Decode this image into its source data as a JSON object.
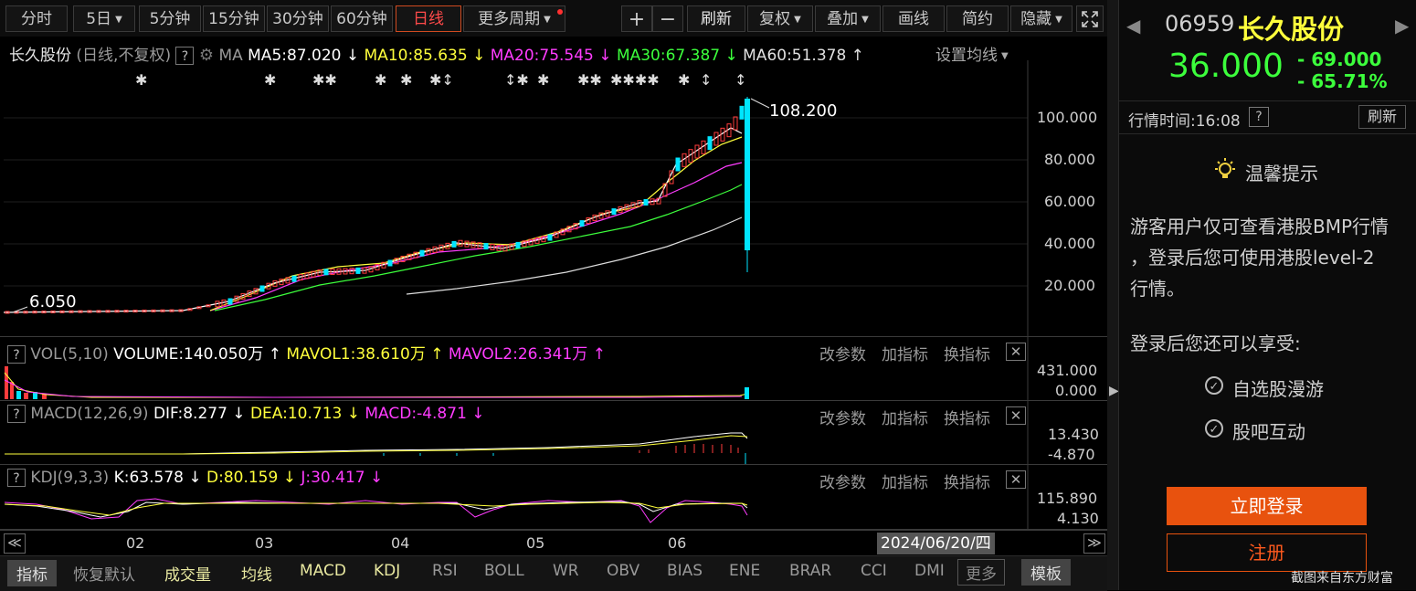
{
  "toolbar": {
    "periods": [
      "分时",
      "5日",
      "5分钟",
      "15分钟",
      "30分钟",
      "60分钟",
      "日线",
      "更多周期"
    ],
    "selected": "日线",
    "plus": "+",
    "minus": "−",
    "refresh": "刷新",
    "adjust": "复权",
    "overlay": "叠加",
    "draw": "画线",
    "simple": "简约",
    "hide": "隐藏",
    "fullscreen_icon": "fullscreen-icon"
  },
  "main_legend": {
    "stock": "长久股份",
    "mode": "(日线,不复权)",
    "help": "?",
    "gear_icon": "gear-icon",
    "ma": "MA",
    "ma5": "MA5:87.020 ↓",
    "ma10": "MA10:85.635 ↓",
    "ma20": "MA20:75.545 ↓",
    "ma30": "MA30:67.387 ↓",
    "ma60": "MA60:51.378 ↑",
    "set_ma": "设置均线"
  },
  "price_axis": [
    "100.000",
    "80.000",
    "60.000",
    "40.000",
    "20.000"
  ],
  "annotations": {
    "high": "108.200",
    "low": "6.050"
  },
  "vol_panel": {
    "help": "?",
    "name": "VOL(5,10)",
    "volume": "VOLUME:140.050万 ↑",
    "mavol1": "MAVOL1:38.610万 ↑",
    "mavol2": "MAVOL2:26.341万 ↑",
    "axis": [
      "431.000",
      "0.000"
    ]
  },
  "macd_panel": {
    "help": "?",
    "name": "MACD(12,26,9)",
    "dif": "DIF:8.277 ↓",
    "dea": "DEA:10.713 ↓",
    "macd": "MACD:-4.871 ↓",
    "axis": [
      "13.430",
      "-4.870"
    ]
  },
  "kdj_panel": {
    "help": "?",
    "name": "KDJ(9,3,3)",
    "k": "K:63.578 ↓",
    "d": "D:80.159 ↓",
    "j": "J:30.417 ↓",
    "axis": [
      "115.890",
      "4.130"
    ]
  },
  "panel_buttons": {
    "params": "改参数",
    "add": "加指标",
    "switch": "换指标",
    "close": "✕"
  },
  "x_axis": {
    "months": [
      "02",
      "03",
      "04",
      "05",
      "06"
    ],
    "date": "2024/06/20/四",
    "left_arrow": "≪",
    "right_arrow": "≫"
  },
  "bottom_tabs": [
    "指标",
    "恢复默认",
    "成交量",
    "均线",
    "MACD",
    "KDJ",
    "RSI",
    "BOLL",
    "WR",
    "OBV",
    "BIAS",
    "ENE",
    "BRAR",
    "CCI",
    "DMI",
    "更多",
    "模板"
  ],
  "right_panel": {
    "code": "06959",
    "name": "长久股份",
    "price": "36.000",
    "change": "- 69.000",
    "change_pct": "- 65.71%",
    "time_label": "行情时间:16:08",
    "help": "?",
    "refresh": "刷新",
    "tip_title": "温馨提示",
    "tip_body_1": "游客用户仅可查看港股BMP行情",
    "tip_body_2": "，登录后您可使用港股level-2",
    "tip_body_3": "行情。",
    "login_enjoy": "登录后您还可以享受:",
    "feature1": "自选股漫游",
    "feature2": "股吧互动",
    "login_btn": "立即登录",
    "register_btn": "注册",
    "footer": "截图来自东方财富"
  },
  "colors": {
    "up": "#ff3c3c",
    "down": "#00e5ff",
    "ma5": "#ffffff",
    "ma10": "#ffff3c",
    "ma20": "#ff3cff",
    "ma30": "#3cff3c",
    "ma60": "#dddddd",
    "price_green": "#3cff3c",
    "login": "#e8520e"
  }
}
